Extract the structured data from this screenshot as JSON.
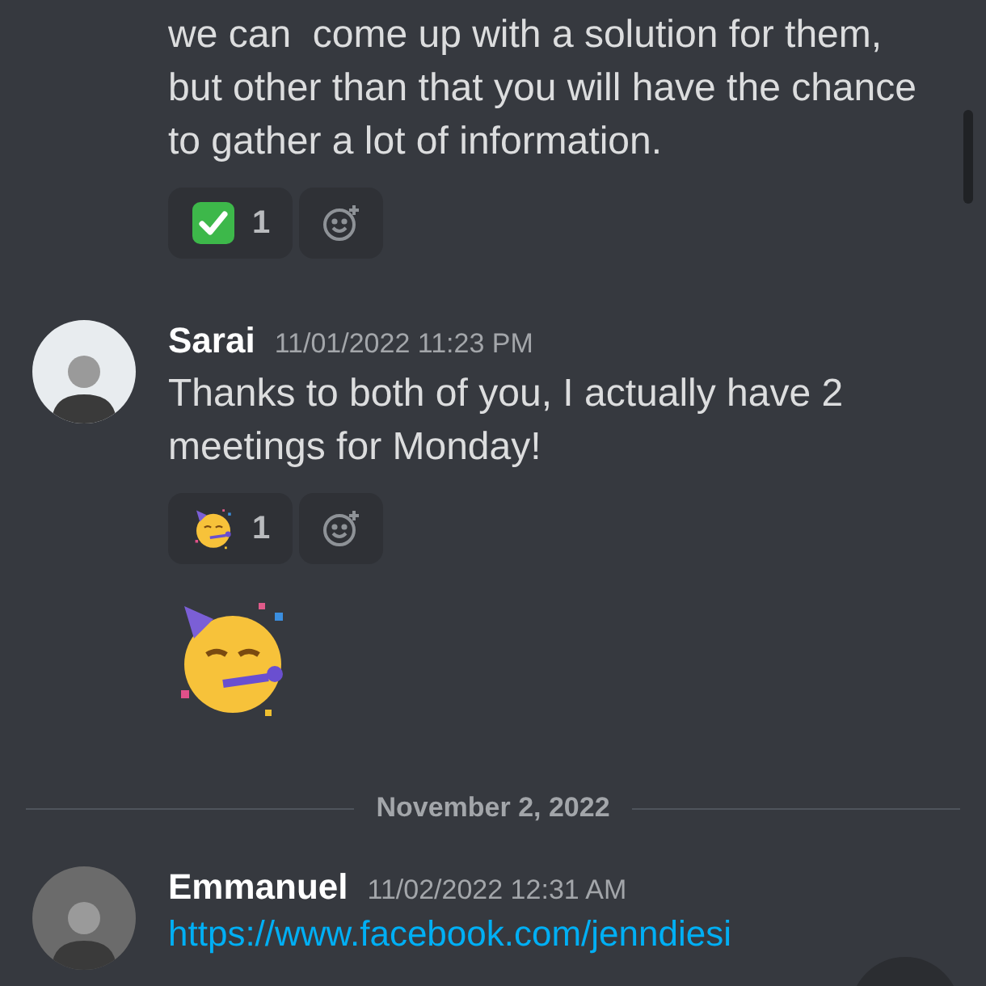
{
  "messages": [
    {
      "kind": "text",
      "text": "we can  come up with a solution for them, but other than that you will have the chance to gather a lot of information.",
      "reactions": [
        {
          "kind": "check",
          "count": "1"
        }
      ]
    },
    {
      "kind": "text",
      "author": "Sarai",
      "timestamp": "11/01/2022 11:23 PM",
      "text": "Thanks to both of you, I actually have 2 meetings for Monday!",
      "reactions": [
        {
          "kind": "party",
          "count": "1"
        }
      ]
    },
    {
      "kind": "emoji"
    },
    {
      "kind": "divider",
      "date": "November 2, 2022"
    },
    {
      "kind": "link",
      "author": "Emmanuel",
      "timestamp": "11/02/2022 12:31 AM",
      "text": "https://www.facebook.com/jenndiesi"
    }
  ]
}
